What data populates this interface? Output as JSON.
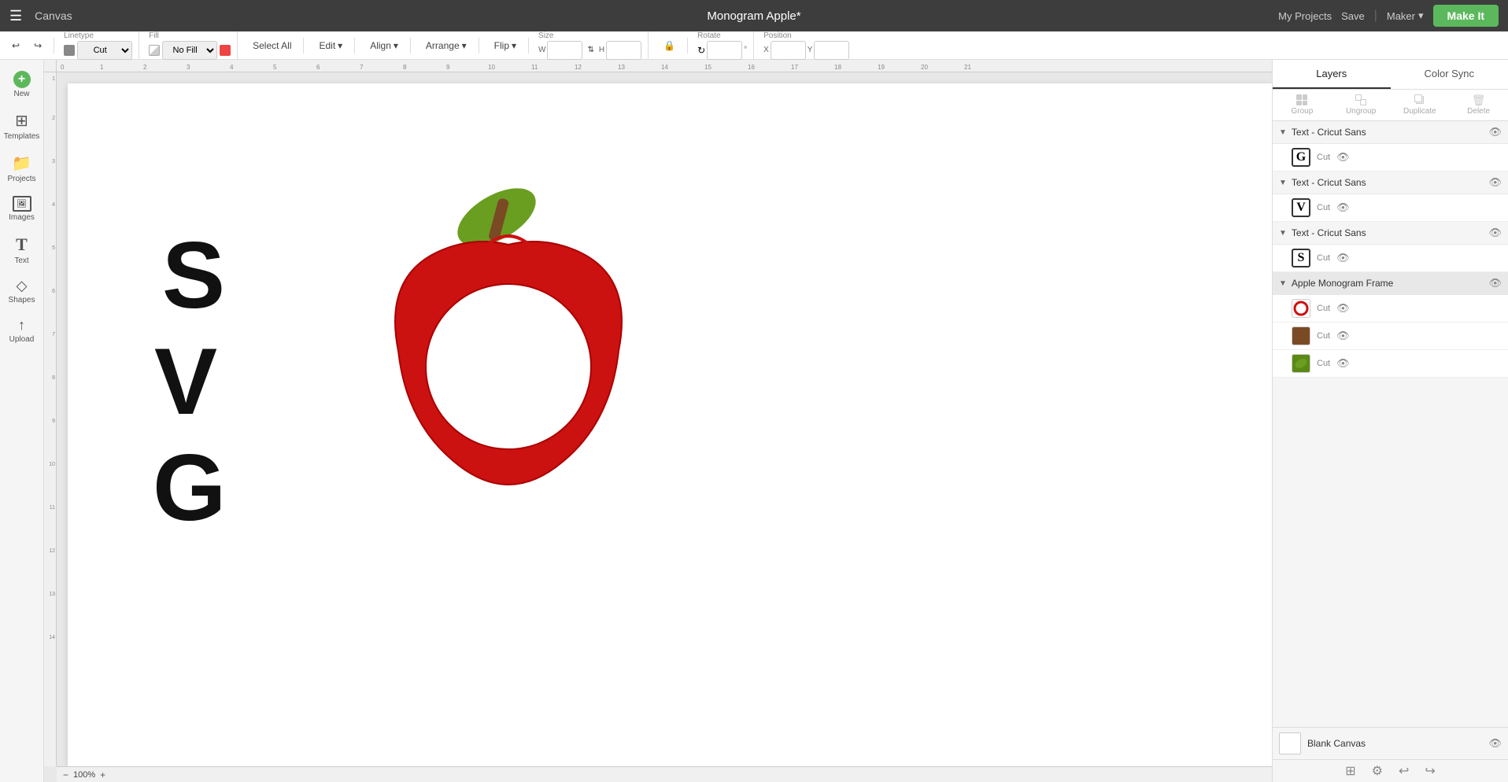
{
  "topNav": {
    "hamburger": "☰",
    "canvasLabel": "Canvas",
    "title": "Monogram Apple*",
    "myProjects": "My Projects",
    "save": "Save",
    "maker": "Maker",
    "makeIt": "Make It"
  },
  "toolbar": {
    "undo": "↩",
    "redo": "↪",
    "linetypeLabel": "Linetype",
    "linetypeValue": "Cut",
    "fillLabel": "Fill",
    "fillValue": "No Fill",
    "selectAll": "Select All",
    "edit": "Edit",
    "align": "Align",
    "arrange": "Arrange",
    "flip": "Flip",
    "size": "Size",
    "rotate": "Rotate",
    "position": "Position"
  },
  "sidebar": {
    "items": [
      {
        "id": "new",
        "icon": "+",
        "label": "New"
      },
      {
        "id": "templates",
        "icon": "⊞",
        "label": "Templates"
      },
      {
        "id": "projects",
        "icon": "📁",
        "label": "Projects"
      },
      {
        "id": "images",
        "icon": "🖼",
        "label": "Images"
      },
      {
        "id": "text",
        "icon": "T",
        "label": "Text"
      },
      {
        "id": "shapes",
        "icon": "◇",
        "label": "Shapes"
      },
      {
        "id": "upload",
        "icon": "↑",
        "label": "Upload"
      }
    ]
  },
  "rightPanel": {
    "tabs": [
      "Layers",
      "Color Sync"
    ],
    "activeTab": "Layers",
    "layerActions": [
      "Group",
      "Ungroup",
      "Duplicate",
      "Delete"
    ],
    "layerGroups": [
      {
        "name": "Text - Cricut Sans",
        "expanded": true,
        "items": [
          {
            "letter": "G",
            "type": "Cut",
            "color": "#000000"
          }
        ]
      },
      {
        "name": "Text - Cricut Sans",
        "expanded": true,
        "items": [
          {
            "letter": "V",
            "type": "Cut",
            "color": "#000000"
          }
        ]
      },
      {
        "name": "Text - Cricut Sans",
        "expanded": true,
        "items": [
          {
            "letter": "S",
            "type": "Cut",
            "color": "#000000"
          }
        ]
      },
      {
        "name": "Apple Monogram Frame",
        "expanded": true,
        "items": [
          {
            "letter": "O",
            "type": "Cut",
            "color": "#cc0000",
            "isCircle": true
          },
          {
            "letter": "╱",
            "type": "Cut",
            "color": "#6b3a2a",
            "isStem": true
          },
          {
            "letter": "◆",
            "type": "Cut",
            "color": "#4a7c20",
            "isLeaf": true
          }
        ]
      }
    ],
    "blankCanvas": "Blank Canvas"
  },
  "zoom": {
    "value": "100%"
  },
  "canvas": {
    "title": "Monogram Apple"
  }
}
